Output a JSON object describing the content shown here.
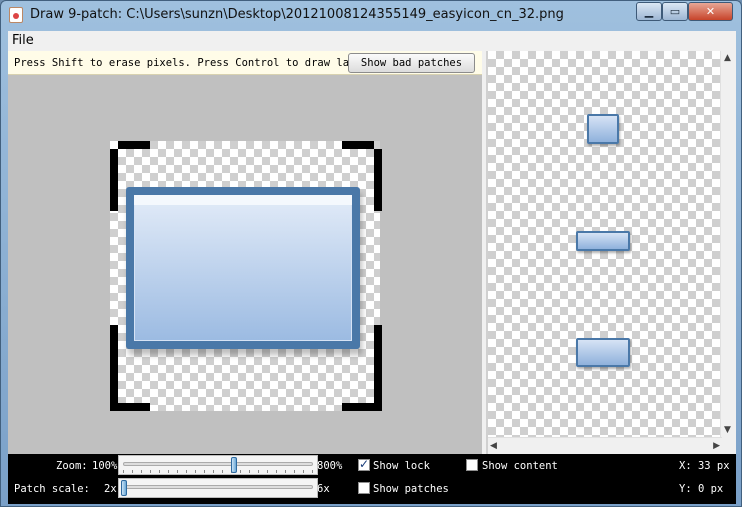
{
  "window": {
    "title": "Draw 9-patch: C:\\Users\\sunzn\\Desktop\\20121008124355149_easyicon_cn_32.png",
    "buttons": {
      "minimize": "▁",
      "maximize": "▭",
      "close": "✕"
    }
  },
  "menu": {
    "file": "File"
  },
  "editor": {
    "hint": "Press Shift to erase pixels. Press Control to draw layout bounds",
    "show_bad_patches": "Show bad patches"
  },
  "controls": {
    "zoom_label": "Zoom:",
    "zoom_min": "100%",
    "zoom_max": "800%",
    "zoom_value": 0.6,
    "patch_scale_label": "Patch scale:",
    "patch_scale_min": "2x",
    "patch_scale_max": "6x",
    "patch_scale_value": 0.0,
    "show_lock": {
      "label": "Show lock",
      "checked": true
    },
    "show_content": {
      "label": "Show content",
      "checked": false
    },
    "show_patches": {
      "label": "Show patches",
      "checked": false
    },
    "x_readout": "X:  33 px",
    "y_readout": "Y:   0 px"
  },
  "colors": {
    "patch_border": "#4a78a8",
    "patch_fill_top": "#e2ebf8",
    "patch_fill_bottom": "#9cbbe2",
    "hint_background": "#fffce8"
  },
  "icons": {
    "app": "java-app-icon",
    "scroll_up": "arrow-up-icon",
    "scroll_down": "arrow-down-icon",
    "scroll_left": "arrow-left-icon",
    "scroll_right": "arrow-right-icon"
  }
}
